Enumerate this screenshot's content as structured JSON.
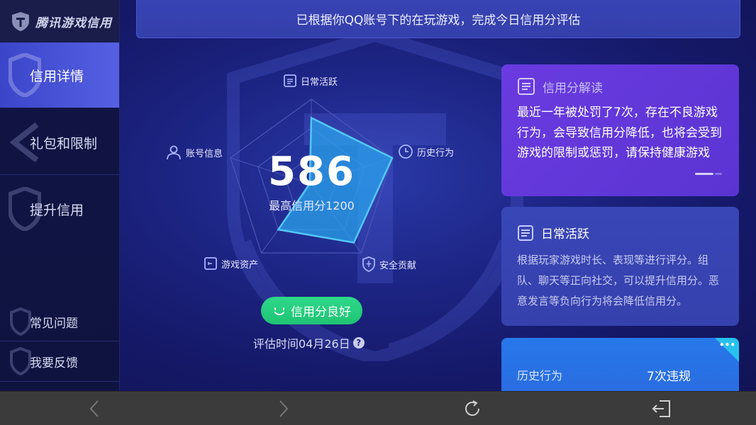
{
  "app": {
    "logo_text": "腾讯游戏信用"
  },
  "sidebar": {
    "items": [
      {
        "label": "信用详情",
        "active": true
      },
      {
        "label": "礼包和限制",
        "active": false
      },
      {
        "label": "提升信用",
        "active": false
      }
    ],
    "bottom_items": [
      {
        "label": "常见问题"
      },
      {
        "label": "我要反馈"
      }
    ]
  },
  "banner": {
    "text": "已根据你QQ账号下的在玩游戏，完成今日信用分评估"
  },
  "score": {
    "value": "586",
    "max_label": "最高信用分1200",
    "status": "信用分良好",
    "eval_time": "评估时间04月26日"
  },
  "radar": {
    "axes": [
      {
        "label": "日常活跃",
        "icon": "doc-icon",
        "value": 0.78
      },
      {
        "label": "历史行为",
        "icon": "clock-icon",
        "value": 1.0
      },
      {
        "label": "安全贡献",
        "icon": "shield-icon",
        "value": 0.85
      },
      {
        "label": "游戏资产",
        "icon": "asset-icon",
        "value": 0.66
      },
      {
        "label": "账号信息",
        "icon": "user-icon",
        "value": 0.02
      }
    ]
  },
  "cards": {
    "interpret": {
      "title": "信用分解读",
      "body": "最近一年被处罚了7次，存在不良游戏行为，会导致信用分降低，也将会受到游戏的限制或惩罚，请保持健康游戏"
    },
    "daily": {
      "title": "日常活跃",
      "body": "根据玩家游戏时长、表现等进行评分。组队、聊天等正向社交，可以提升信用分。恶意发言等负向行为将会降低信用分。"
    },
    "history": {
      "label": "历史行为",
      "value": "7次违规"
    }
  },
  "colors": {
    "accent_green": "#22c97a",
    "card_purple": "#6a3be0",
    "card_blue": "#3946b6",
    "card_cyan": "#2778ea",
    "radar_fill": "#2aa6ee"
  },
  "navbar": {
    "buttons": [
      "back-icon",
      "forward-icon",
      "refresh-icon",
      "exit-icon"
    ]
  }
}
